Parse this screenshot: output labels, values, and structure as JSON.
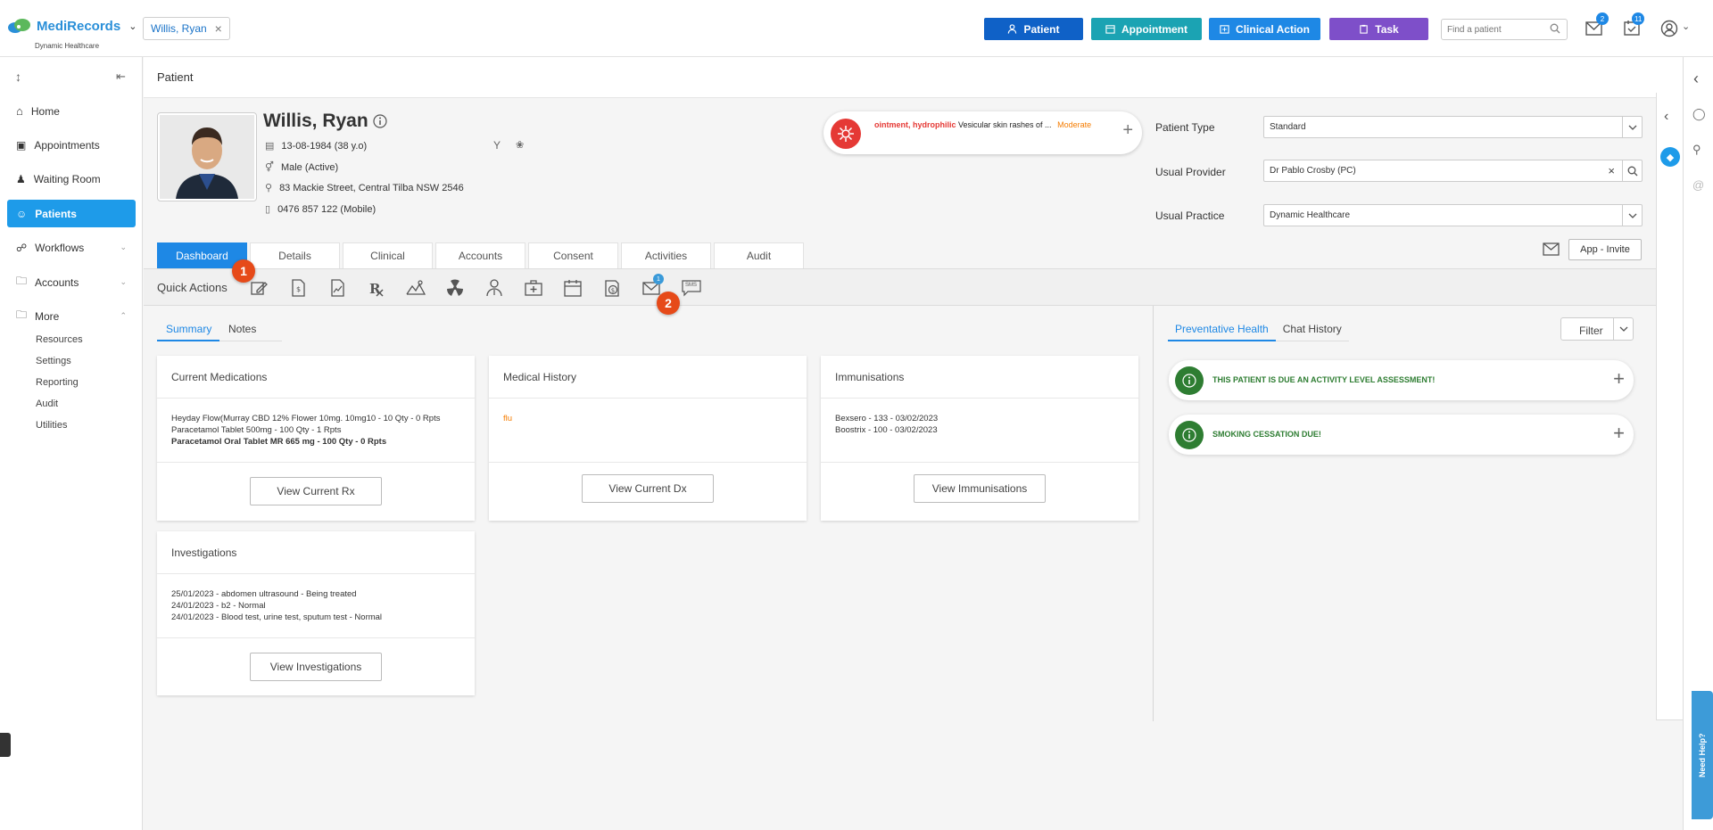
{
  "app": {
    "name": "MediRecords",
    "subtitle": "Dynamic Healthcare"
  },
  "open_patient_chip": "Willis, Ryan",
  "toolbar": {
    "patient": {
      "label": "Patient",
      "color": "#0f61c7"
    },
    "appointment": {
      "label": "Appointment",
      "color": "#1ba3b3"
    },
    "clinical_action": {
      "label": "Clinical Action",
      "color": "#1e88e5"
    },
    "task": {
      "label": "Task",
      "color": "#7e4fc9"
    },
    "search_placeholder": "Find a patient",
    "mail_badge": "2",
    "tasks_badge": "11"
  },
  "sidebar": {
    "items": [
      {
        "label": "Home",
        "icon": "home-icon"
      },
      {
        "label": "Appointments",
        "icon": "calendar-icon"
      },
      {
        "label": "Waiting Room",
        "icon": "waiting-room-icon"
      },
      {
        "label": "Patients",
        "icon": "patients-icon",
        "active": true
      },
      {
        "label": "Workflows",
        "icon": "workflow-icon"
      },
      {
        "label": "Accounts",
        "icon": "folder-icon"
      },
      {
        "label": "More",
        "icon": "folder-icon"
      }
    ],
    "more_items": [
      "Resources",
      "Settings",
      "Reporting",
      "Audit",
      "Utilities"
    ]
  },
  "page_title": "Patient",
  "patient": {
    "name": "Willis, Ryan",
    "dob": "13-08-1984 (38 y.o)",
    "gender": "Male (Active)",
    "address": "83 Mackie Street, Central Tilba NSW 2546",
    "phone": "0476 857 122 (Mobile)"
  },
  "allergy": {
    "substance": "ointment, hydrophilic",
    "reaction": "Vesicular skin rashes of ...",
    "severity": "Moderate"
  },
  "fields": {
    "patient_type": {
      "label": "Patient Type",
      "value": "Standard"
    },
    "usual_provider": {
      "label": "Usual Provider",
      "value": "Dr Pablo Crosby (PC)"
    },
    "usual_practice": {
      "label": "Usual Practice",
      "value": "Dynamic Healthcare"
    }
  },
  "tabs": [
    "Dashboard",
    "Details",
    "Clinical",
    "Accounts",
    "Consent",
    "Activities",
    "Audit"
  ],
  "app_invite": "App - Invite",
  "quick_actions": {
    "title": "Quick Actions",
    "mail_badge": "1",
    "sms_label": "SMS"
  },
  "markers": [
    "1",
    "2"
  ],
  "subtabs": [
    "Summary",
    "Notes"
  ],
  "cards": {
    "medications": {
      "title": "Current Medications",
      "lines": [
        "Heyday Flow(Murray CBD 12% Flower 10mg. 10mg10 - 10 Qty - 0 Rpts",
        "Paracetamol Tablet 500mg - 100 Qty - 1 Rpts",
        "Paracetamol Oral Tablet MR 665 mg - 100 Qty - 0 Rpts"
      ],
      "button": "View Current Rx"
    },
    "history": {
      "title": "Medical History",
      "lines": [
        "flu"
      ],
      "button": "View Current Dx"
    },
    "immunisations": {
      "title": "Immunisations",
      "lines": [
        "Bexsero - 133 - 03/02/2023",
        "Boostrix - 100 - 03/02/2023"
      ],
      "button": "View Immunisations"
    },
    "investigations": {
      "title": "Investigations",
      "lines": [
        "25/01/2023 - abdomen ultrasound - Being treated",
        "24/01/2023 - b2 - Normal",
        "24/01/2023 - Blood test, urine test, sputum test - Normal"
      ],
      "button": "View Investigations"
    }
  },
  "right_tabs": [
    "Preventative Health",
    "Chat History"
  ],
  "filter_label": "Filter",
  "preventative": [
    "THIS PATIENT IS DUE AN ACTIVITY LEVEL ASSESSMENT!",
    "SMOKING CESSATION DUE!"
  ],
  "need_help": "Need Help?"
}
